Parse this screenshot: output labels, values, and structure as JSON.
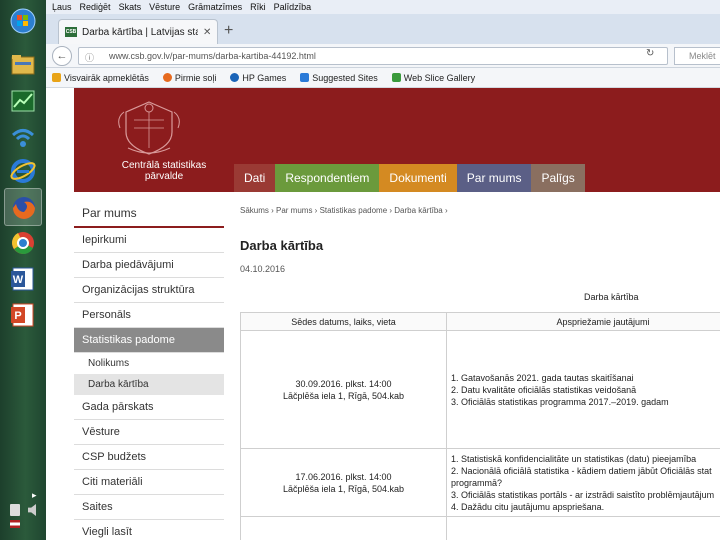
{
  "taskbar": {
    "buttons": [
      {
        "icon": "windows-orb-icon",
        "color": "#2c7fcf"
      },
      {
        "icon": "file-explorer-icon",
        "color": "#e1b94b"
      },
      {
        "icon": "task-manager-icon",
        "color": "#2a9a3c"
      },
      {
        "icon": "wifi-icon",
        "color": "#3a8fd8"
      },
      {
        "icon": "internet-explorer-icon",
        "color": "#2a7ad8"
      },
      {
        "icon": "firefox-icon",
        "color": "#e66a1f"
      },
      {
        "icon": "chrome-icon",
        "color": "#d94032"
      },
      {
        "icon": "word-icon",
        "color": "#2b579a"
      },
      {
        "icon": "powerpoint-icon",
        "color": "#d24726"
      }
    ]
  },
  "browser": {
    "menu": [
      "Ļaus",
      "Rediģēt",
      "Skats",
      "Vēsture",
      "Grāmatzīmes",
      "Rīki",
      "Palīdzība"
    ],
    "tab_title": "Darba kārtība | Latvijas statis...",
    "tab_favicon": "CSB",
    "url": "www.csb.gov.lv/par-mums/darba-kartiba-44192.html",
    "search_placeholder": "Meklēt",
    "bookmarks": [
      {
        "label": "Visvairāk apmeklētās",
        "icon": "star-icon"
      },
      {
        "label": "Pirmie soļi",
        "icon": "firefox-bookmark-icon"
      },
      {
        "label": "HP Games",
        "icon": "hp-icon"
      },
      {
        "label": "Suggested Sites",
        "icon": "ie-bookmark-icon"
      },
      {
        "label": "Web Slice Gallery",
        "icon": "web-slice-icon"
      }
    ]
  },
  "site": {
    "name_line1": "Centrālā statistikas",
    "name_line2": "pārvalde",
    "header_color": "#8c1c1d",
    "nav": [
      {
        "label": "Dati",
        "color": "#9a3a34"
      },
      {
        "label": "Respondentiem",
        "color": "#6b9a3c"
      },
      {
        "label": "Dokumenti",
        "color": "#d48a22"
      },
      {
        "label": "Par mums",
        "color": "#5b5f86"
      },
      {
        "label": "Palīgs",
        "color": "#8a6f60"
      }
    ],
    "sidebar": {
      "heading": "Par mums",
      "items": [
        "Iepirkumi",
        "Darba piedāvājumi",
        "Organizācijas struktūra",
        "Personāls"
      ],
      "active": "Statistikas padome",
      "subitems": [
        "Nolikums",
        "Darba kārtība"
      ],
      "items_after": [
        "Gada pārskats",
        "Vēsture",
        "CSP budžets",
        "Citi materiāli",
        "Saites",
        "Viegli lasīt"
      ]
    },
    "breadcrumb": "Sākums › Par mums › Statistikas padome › Darba kārtība ›",
    "title": "Darba kārtība",
    "date": "04.10.2016",
    "table_caption": "Darba kārtība",
    "table": {
      "headers": [
        "Sēdes datums, laiks, vieta",
        "Apspriežamie jautājumi"
      ],
      "rows": [
        {
          "date": "30.09.2016. plkst. 14:00",
          "place": "Lāčplēša iela 1, Rīgā, 504.kab",
          "questions": [
            "1. Gatavošanās 2021. gada tautas skaitīšanai",
            "2. Datu kvalitāte oficiālās statistikas veidošanā",
            "3. Oficiālās statistikas programma 2017.–2019. gadam"
          ]
        },
        {
          "date": "17.06.2016. plkst. 14:00",
          "place": "Lāčplēša iela 1, Rīgā, 504.kab",
          "questions": [
            "1. Statistiskā konfidencialitāte un statistikas (datu) pieejamība",
            "2. Nacionālā oficiālā statistika - kādiem datiem jābūt Oficiālās stat",
            "programmā?",
            "3. Oficiālās statistikas portāls - ar izstrādi saistīto problēmjautājum",
            "4. Dažādu citu jautājumu apspriešana."
          ]
        }
      ]
    }
  }
}
